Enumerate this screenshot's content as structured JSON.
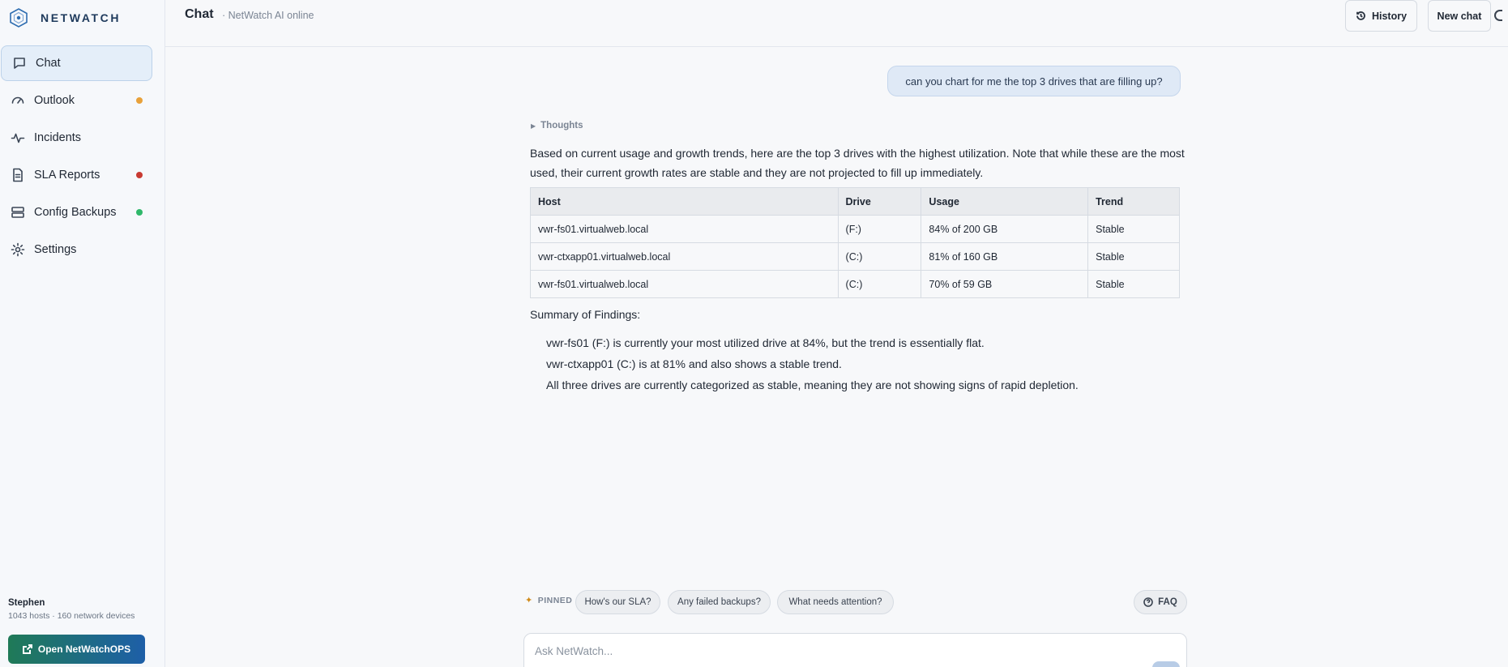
{
  "brand": {
    "name": "NETWATCH"
  },
  "sidebar": {
    "items": [
      {
        "label": "Chat",
        "icon": "chat-icon",
        "active": true,
        "dot": null
      },
      {
        "label": "Outlook",
        "icon": "gauge-icon",
        "active": false,
        "dot": "#e8a13a"
      },
      {
        "label": "Incidents",
        "icon": "pulse-icon",
        "active": false,
        "dot": null
      },
      {
        "label": "SLA Reports",
        "icon": "document-icon",
        "active": false,
        "dot": "#c83a32"
      },
      {
        "label": "Config Backups",
        "icon": "server-icon",
        "active": false,
        "dot": "#2fb86a"
      },
      {
        "label": "Settings",
        "icon": "gear-icon",
        "active": false,
        "dot": null
      }
    ],
    "user": {
      "name": "Stephen",
      "meta": "1043 hosts · 160 network devices"
    },
    "open_ops_label": "Open NetWatchOPS"
  },
  "header": {
    "title": "Chat",
    "subtitle": "· NetWatch AI online",
    "history_label": "History",
    "new_chat_label": "New chat"
  },
  "chat": {
    "user_message": "can you chart for me the top 3 drives that are filling up?",
    "thoughts_label": "Thoughts",
    "intro": "Based on current usage and growth trends, here are the top 3 drives with the highest utilization. Note that while these are the most used, their current growth rates are stable and they are not projected to fill up immediately.",
    "table": {
      "headers": [
        "Host",
        "Drive",
        "Usage",
        "Trend"
      ],
      "rows": [
        [
          "vwr-fs01.virtualweb.local",
          "(F:)",
          "84% of 200 GB",
          "Stable"
        ],
        [
          "vwr-ctxapp01.virtualweb.local",
          "(C:)",
          "81% of 160 GB",
          "Stable"
        ],
        [
          "vwr-fs01.virtualweb.local",
          "(C:)",
          "70% of 59 GB",
          "Stable"
        ]
      ]
    },
    "summary_title": "Summary of Findings:",
    "summary_items": [
      "vwr-fs01 (F:) is currently your most utilized drive at 84%, but the trend is essentially flat.",
      "vwr-ctxapp01 (C:) is at 81% and also shows a stable trend.",
      "All three drives are currently categorized as stable, meaning they are not showing signs of rapid depletion."
    ]
  },
  "pinned": {
    "label": "PINNED",
    "prompts": [
      "How's our SLA?",
      "Any failed backups?",
      "What needs attention?"
    ],
    "faq_label": "FAQ"
  },
  "composer": {
    "placeholder": "Ask NetWatch..."
  },
  "colors": {
    "accent": "#1e5fa8",
    "active_nav_bg": "#e4eef9",
    "ops_green": "#1f7a57"
  }
}
